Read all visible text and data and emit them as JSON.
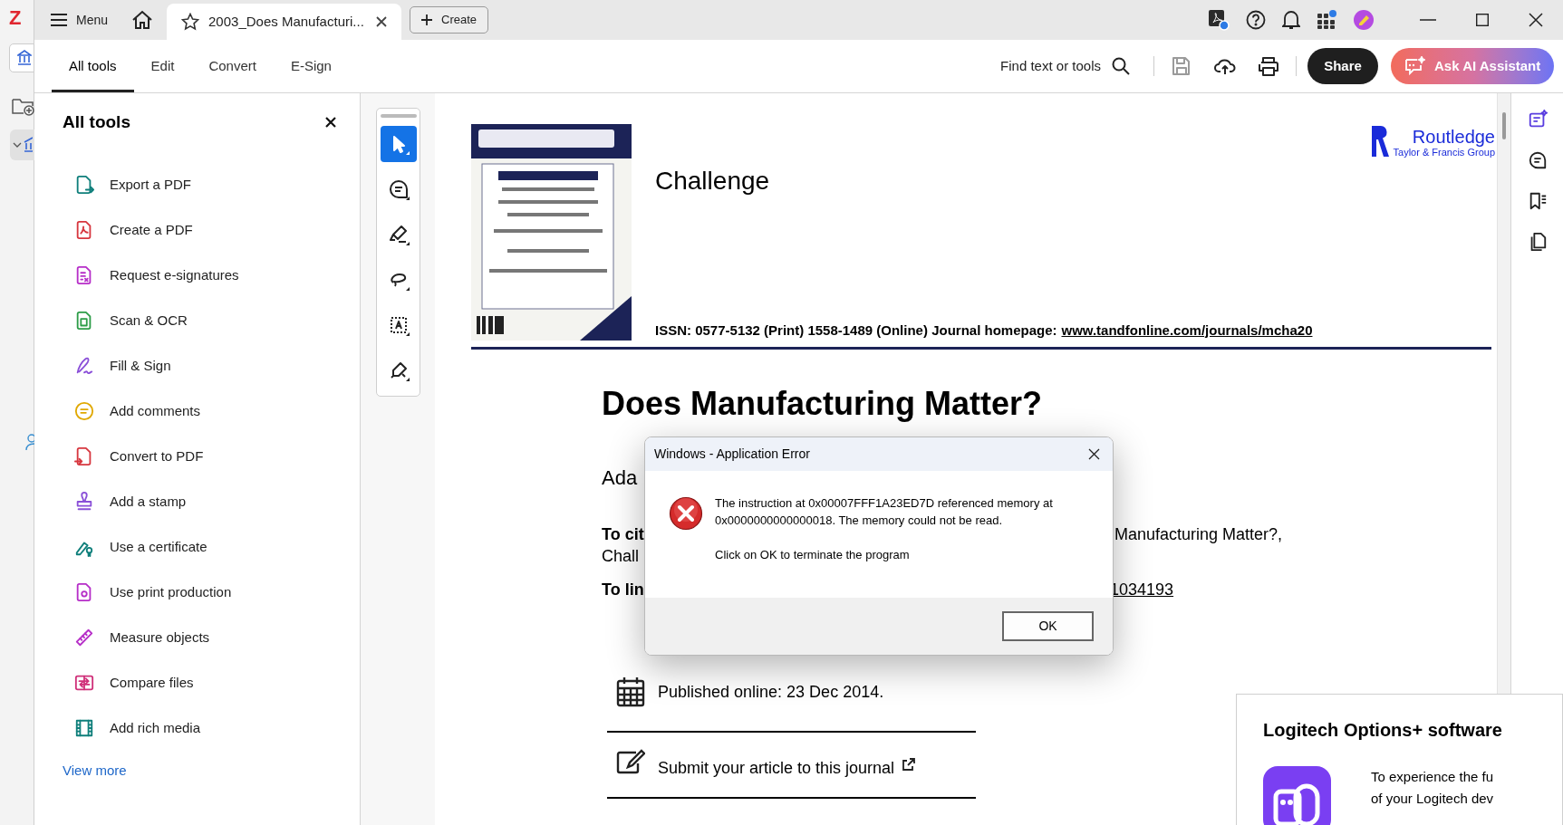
{
  "side_app": {
    "logo": "Z"
  },
  "title_bar": {
    "menu": "Menu",
    "tab": "2003_Does Manufacturi...",
    "create": "Create"
  },
  "toolbar": {
    "tabs": [
      {
        "label": "All tools",
        "selected": true
      },
      {
        "label": "Edit",
        "selected": false
      },
      {
        "label": "Convert",
        "selected": false
      },
      {
        "label": "E-Sign",
        "selected": false
      }
    ],
    "search": "Find text or tools",
    "actions": [
      {
        "kind": "save",
        "disabled": true
      },
      {
        "kind": "upload",
        "disabled": false
      },
      {
        "kind": "print",
        "disabled": false
      }
    ],
    "share": "Share",
    "ai": "Ask AI Assistant"
  },
  "tools_panel": {
    "title": "All tools",
    "items": [
      {
        "label": "Export a PDF",
        "color": "#0f7f7b"
      },
      {
        "label": "Create a PDF",
        "color": "#d7373f"
      },
      {
        "label": "Request e-signatures",
        "color": "#b62ec8"
      },
      {
        "label": "Scan & OCR",
        "color": "#2d9d48"
      },
      {
        "label": "Fill & Sign",
        "color": "#8a4fd8"
      },
      {
        "label": "Add comments",
        "color": "#e0a800"
      },
      {
        "label": "Convert to PDF",
        "color": "#d7373f"
      },
      {
        "label": "Add a stamp",
        "color": "#8a4fd8"
      },
      {
        "label": "Use a certificate",
        "color": "#0f7f7b"
      },
      {
        "label": "Use print production",
        "color": "#b62ec8"
      },
      {
        "label": "Measure objects",
        "color": "#b62ec8"
      },
      {
        "label": "Compare files",
        "color": "#d0317a"
      },
      {
        "label": "Add rich media",
        "color": "#0f7f7b"
      }
    ],
    "view_more": "View more"
  },
  "quick_tools": [
    {
      "kind": "select",
      "selected": true
    },
    {
      "kind": "comment",
      "selected": false
    },
    {
      "kind": "highlight",
      "selected": false
    },
    {
      "kind": "draw",
      "selected": false
    },
    {
      "kind": "textbox",
      "selected": false
    },
    {
      "kind": "sign",
      "selected": false
    }
  ],
  "document": {
    "journal": "Challenge",
    "publisher": "Routledge",
    "publisher_group": "Taylor & Francis Group",
    "issn": "ISSN: 0577-5132 (Print) 1558-1489 (Online) Journal homepage:",
    "homepage_link": "www.tandfonline.com/journals/mcha20",
    "title": "Does Manufacturing Matter?",
    "author_fragment": "Ada",
    "cite_label_fragment": "To cit",
    "cite_text_fragment": "Manufacturing Matter?,",
    "cite_line2_fragment": "Chall",
    "link_label_fragment": "To lin",
    "doi_fragment": "1034193",
    "published": "Published online: 23 Dec 2014.",
    "submit": "Submit your article to this journal"
  },
  "right_rail": [
    {
      "kind": "ai",
      "selected": true
    },
    {
      "kind": "comments",
      "selected": false
    },
    {
      "kind": "bookmarks",
      "selected": false
    },
    {
      "kind": "pages",
      "selected": false
    }
  ],
  "dialog": {
    "title": "Windows - Application Error",
    "message": "The instruction at 0x00007FFF1A23ED7D referenced memory at 0x0000000000000018. The memory could not be read.",
    "instruction": "Click on OK to terminate the program",
    "ok": "OK"
  },
  "notification": {
    "title": "Logitech Options+ software",
    "lines": [
      "To experience the fu",
      "of your Logitech dev"
    ]
  }
}
